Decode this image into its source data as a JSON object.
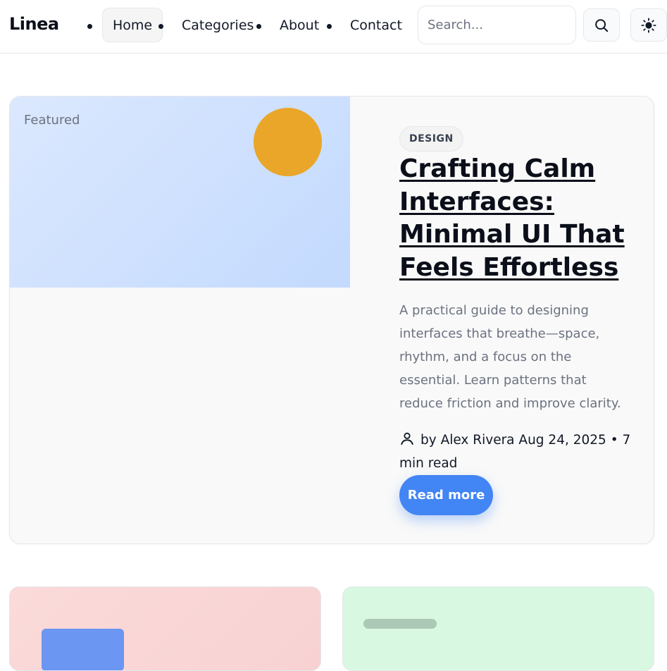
{
  "brand": {
    "logo": "Linea"
  },
  "nav": {
    "items": [
      {
        "label": "Home",
        "active": true
      },
      {
        "label": "Categories",
        "active": false
      },
      {
        "label": "About",
        "active": false
      },
      {
        "label": "Contact",
        "active": false
      }
    ]
  },
  "search": {
    "placeholder": "Search...",
    "value": "",
    "button_icon": "search-icon"
  },
  "theme_toggle": {
    "icon": "sun-icon"
  },
  "featured": {
    "label": "Featured",
    "tag": "DESIGN",
    "title": "Crafting Calm Interfaces: Minimal UI That Feels Effortless",
    "excerpt": "A practical guide to designing interfaces that breathe—space, rhythm, and a focus on the essential. Learn patterns that reduce friction and improve clarity.",
    "author": "by Alex Rivera",
    "date": "Aug 24, 2025",
    "separator": "•",
    "read_time": "7 min read",
    "cta": "Read more",
    "colors": {
      "accent": "#4285f4",
      "sun": "#e9a628",
      "media_bg": "#c3dafe"
    }
  },
  "cards": {
    "colors": {
      "left_bg": "#f8d2d2",
      "right_bg": "#d8f8e2"
    }
  }
}
